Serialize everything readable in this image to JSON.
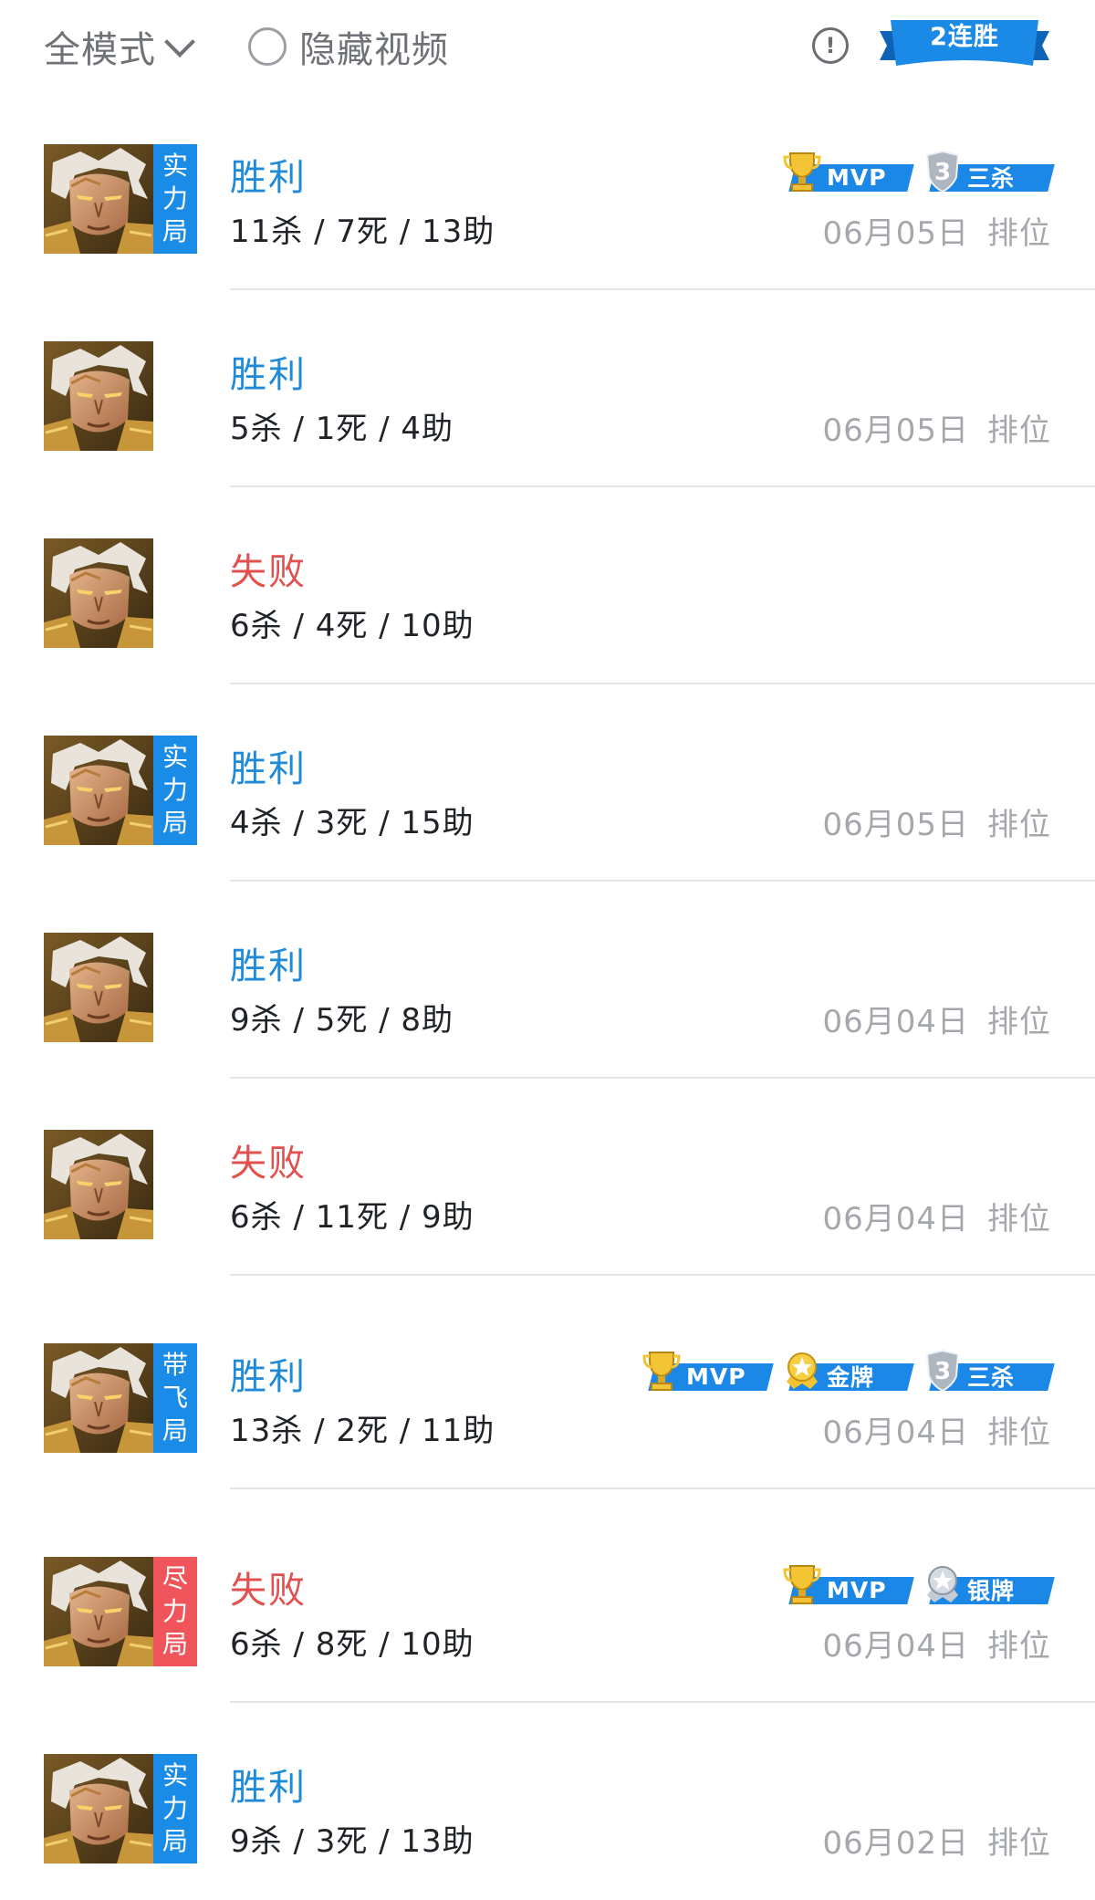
{
  "header": {
    "mode_label": "全模式",
    "hide_video_label": "隐藏视频",
    "info_glyph": "!",
    "streak_label": "2连胜"
  },
  "colors": {
    "win": "#1f8ad6",
    "loss": "#e2514f",
    "tag_blue": "#1a8ce8",
    "tag_red": "#f0555b",
    "badge_blue": "#1b87e6"
  },
  "matches": [
    {
      "result": "胜利",
      "kda": "11杀 / 7死 / 13助",
      "date": "06月05日",
      "mode": "排位",
      "tag": "实力局",
      "badges": [
        "MVP",
        "三杀"
      ]
    },
    {
      "result": "胜利",
      "kda": "5杀 / 1死 / 4助",
      "date": "06月05日",
      "mode": "排位",
      "tag": "",
      "badges": []
    },
    {
      "result": "失败",
      "kda": "6杀 / 4死 / 10助",
      "date": "",
      "mode": "",
      "tag": "",
      "badges": []
    },
    {
      "result": "胜利",
      "kda": "4杀 / 3死 / 15助",
      "date": "06月05日",
      "mode": "排位",
      "tag": "实力局",
      "badges": []
    },
    {
      "result": "胜利",
      "kda": "9杀 / 5死 / 8助",
      "date": "06月04日",
      "mode": "排位",
      "tag": "",
      "badges": []
    },
    {
      "result": "失败",
      "kda": "6杀 / 11死 / 9助",
      "date": "06月04日",
      "mode": "排位",
      "tag": "",
      "badges": []
    },
    {
      "result": "胜利",
      "kda": "13杀 / 2死 / 11助",
      "date": "06月04日",
      "mode": "排位",
      "tag": "带飞局",
      "badges": [
        "MVP",
        "金牌",
        "三杀"
      ]
    },
    {
      "result": "失败",
      "kda": "6杀 / 8死 / 10助",
      "date": "06月04日",
      "mode": "排位",
      "tag": "尽力局",
      "badges": [
        "MVP",
        "银牌"
      ]
    },
    {
      "result": "胜利",
      "kda": "9杀 / 3死 / 13助",
      "date": "06月02日",
      "mode": "排位",
      "tag": "实力局",
      "badges": []
    }
  ]
}
